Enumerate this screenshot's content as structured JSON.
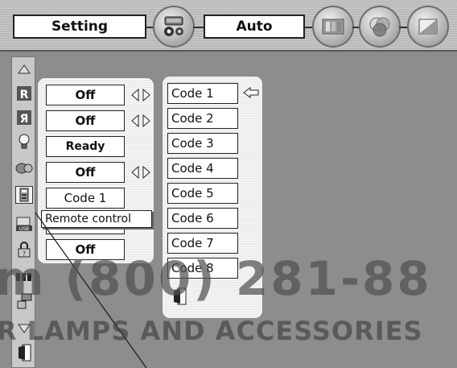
{
  "menu_bar": {
    "setting_label": "Setting",
    "mode_label": "Auto",
    "icons": [
      "projector-icon",
      "picture-adjust-icon",
      "color-icon",
      "screen-icon"
    ]
  },
  "side_menu": {
    "icons": [
      "scroll-up-icon",
      "keystone-icon",
      "mirror-icon",
      "lamp-icon",
      "fan-icon",
      "remote-control-icon",
      "usb-icon",
      "security-icon",
      "network-icon",
      "network-lan-icon",
      "scroll-down-icon",
      "exit-icon"
    ]
  },
  "settings_panel": {
    "values": [
      "Off",
      "Off",
      "Ready",
      "Off",
      "Code 1",
      "",
      "Off"
    ]
  },
  "tooltip": {
    "text": "Remote control"
  },
  "code_panel": {
    "codes": [
      "Code 1",
      "Code 2",
      "Code 3",
      "Code 4",
      "Code 5",
      "Code 6",
      "Code 7",
      "Code 8"
    ],
    "selected": "Code 1"
  },
  "watermark": {
    "line1": "m (800) 281-88",
    "line2": "R LAMPS AND ACCESSORIES"
  }
}
